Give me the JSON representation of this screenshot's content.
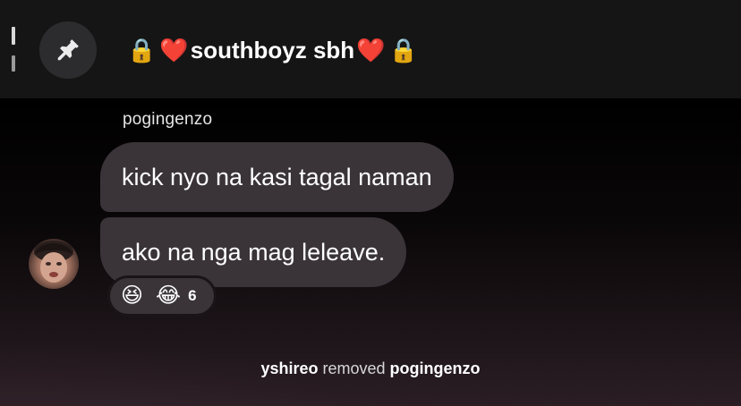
{
  "header": {
    "title_text": "southboyz sbh",
    "title_emojis": [
      "🔒",
      "❤️",
      "❤️",
      "🔒"
    ],
    "pin_icon": "pin-icon"
  },
  "messages": {
    "sender": "pogingenzo",
    "items": [
      {
        "text": "kick nyo na kasi tagal naman"
      },
      {
        "text": "ako na nga mag leleave."
      }
    ],
    "reactions": {
      "emojis": [
        "😆",
        "😂"
      ],
      "count": "6"
    }
  },
  "system_message": {
    "actor": "yshireo",
    "action": "removed",
    "target": "pogingenzo"
  },
  "colors": {
    "bubble": "#3a3439",
    "header": "#151515",
    "pin_button": "#2c2c2e"
  }
}
